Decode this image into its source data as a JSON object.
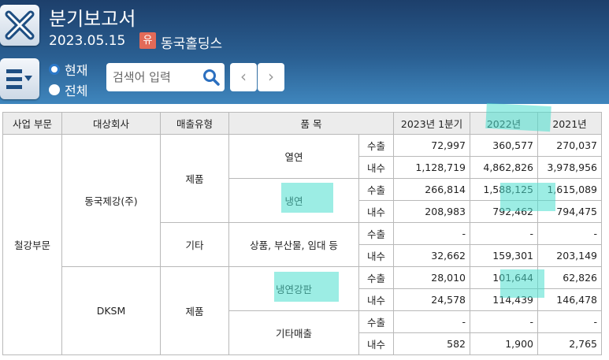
{
  "header": {
    "title": "분기보고서",
    "date": "2023.05.15",
    "badge": "유",
    "company": "동국홀딩스",
    "radio_current": "현재",
    "radio_all": "전체",
    "search_placeholder": "검색어 입력",
    "prev": "‹",
    "next": "›",
    "bg_color": "#2a5f92"
  },
  "table": {
    "headers": [
      "사업 부문",
      "대상회사",
      "매출유형",
      "품 목",
      "2023년 1분기",
      "2022년",
      "2021년"
    ],
    "division": "철강부문",
    "companies": [
      "동국제강(주)",
      "DKSM"
    ],
    "sales_types": [
      "제품",
      "기타",
      "제품"
    ],
    "items": [
      "열연",
      "냉연",
      "상품, 부산물, 임대 등",
      "냉연강판",
      "기타매출"
    ],
    "channels": [
      "수출",
      "내수"
    ],
    "rows": [
      [
        "72,997",
        "360,577",
        "270,037"
      ],
      [
        "1,128,719",
        "4,862,826",
        "3,978,956"
      ],
      [
        "266,814",
        "1,588,125",
        "1,615,089"
      ],
      [
        "208,983",
        "792,462",
        "794,475"
      ],
      [
        "-",
        "-",
        "-"
      ],
      [
        "32,662",
        "159,301",
        "203,149"
      ],
      [
        "28,010",
        "101,644",
        "62,826"
      ],
      [
        "24,578",
        "114,439",
        "146,478"
      ],
      [
        "-",
        "-",
        "-"
      ],
      [
        "582",
        "1,900",
        "2,765"
      ]
    ]
  }
}
